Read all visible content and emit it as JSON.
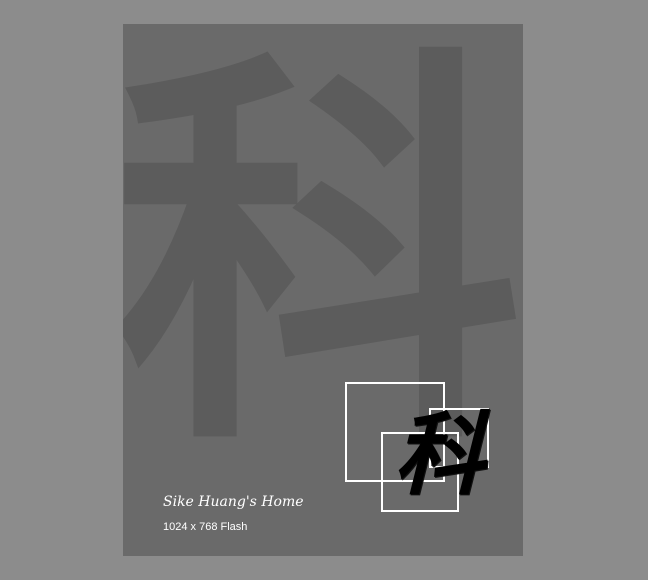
{
  "page": {
    "background_color": "#8c8c8c",
    "panel_color": "#6a6a6a",
    "watermark_color": "#5c5c5c"
  },
  "watermark": {
    "glyph": "科"
  },
  "logo": {
    "glyph": "科",
    "frame_color": "#ffffff",
    "glyph_color": "#000000"
  },
  "intro": {
    "title": "Sike Huang's Home",
    "subtitle": "1024 x 768 Flash"
  }
}
